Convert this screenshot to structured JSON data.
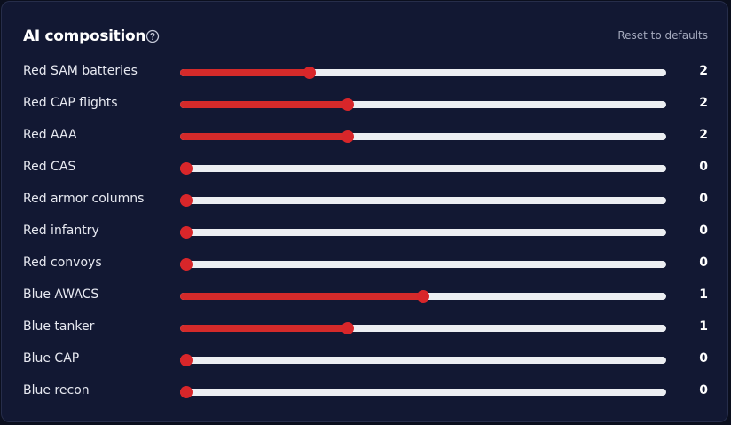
{
  "header": {
    "title": "AI composition",
    "help_icon": "question-circle-icon",
    "reset_label": "Reset to defaults"
  },
  "colors": {
    "panel_bg": "#121833",
    "track": "#eceef2",
    "accent": "#d42a2a"
  },
  "sliders": [
    {
      "label": "Red SAM batteries",
      "value": "2",
      "level": 0.26
    },
    {
      "label": "Red CAP flights",
      "value": "2",
      "level": 0.34
    },
    {
      "label": "Red AAA",
      "value": "2",
      "level": 0.34
    },
    {
      "label": "Red CAS",
      "value": "0",
      "level": 0.0
    },
    {
      "label": "Red armor columns",
      "value": "0",
      "level": 0.0
    },
    {
      "label": "Red infantry",
      "value": "0",
      "level": 0.0
    },
    {
      "label": "Red convoys",
      "value": "0",
      "level": 0.0
    },
    {
      "label": "Blue AWACS",
      "value": "1",
      "level": 0.5
    },
    {
      "label": "Blue tanker",
      "value": "1",
      "level": 0.34
    },
    {
      "label": "Blue CAP",
      "value": "0",
      "level": 0.0
    },
    {
      "label": "Blue recon",
      "value": "0",
      "level": 0.0
    }
  ]
}
